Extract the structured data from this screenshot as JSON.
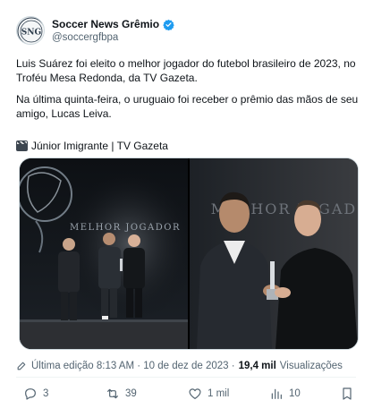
{
  "author": {
    "name": "Soccer News Grêmio",
    "handle": "@soccergfbpa",
    "avatar_text": "SNG"
  },
  "tweet": {
    "paragraph1": "Luis Suárez foi eleito o melhor jogador do futebol brasileiro de 2023, no Troféu Mesa Redonda, da TV Gazeta.",
    "paragraph2": "Na última quinta-feira, o uruguaio foi receber o prêmio das mãos de seu amigo, Lucas Leiva.",
    "credit": "Júnior Imigrante | TV Gazeta"
  },
  "media": {
    "left_screen_text": "MELHOR JOGADOR",
    "right_screen_text": "MELHOR JOGADOR"
  },
  "meta": {
    "edited_label": "Última edição 8:13 AM · 10 de dez de 2023 · ",
    "views_count": "19,4 mil",
    "views_label": " Visualizações"
  },
  "actions": {
    "replies": "3",
    "reposts": "39",
    "likes": "1 mil",
    "views": "10"
  },
  "colors": {
    "verified": "#1d9bf0",
    "muted_text": "#536471",
    "primary_text": "#0f1419"
  }
}
